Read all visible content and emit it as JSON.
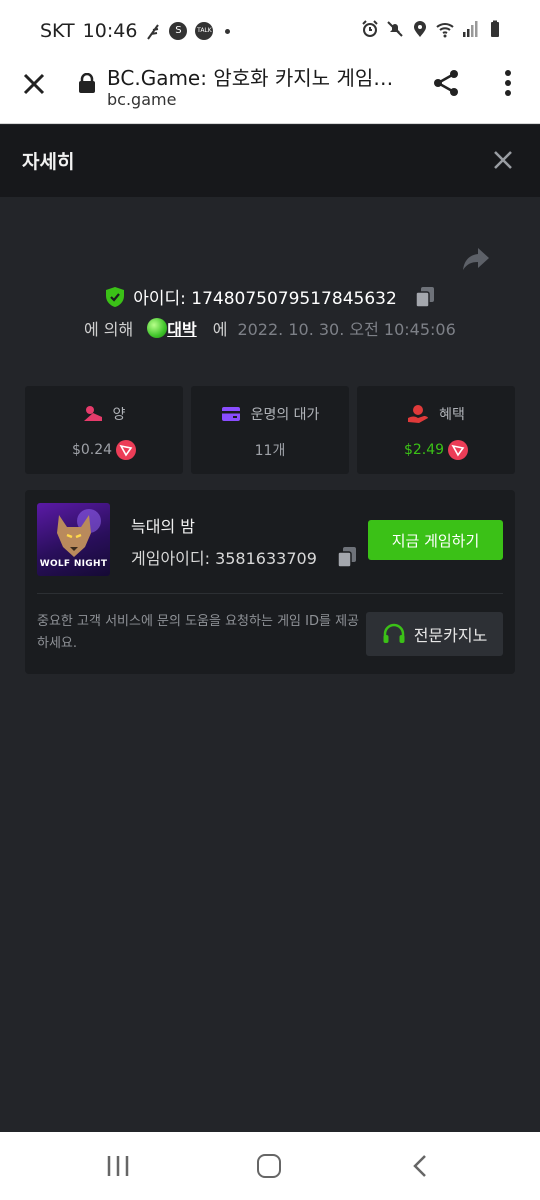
{
  "status_bar": {
    "carrier": "SKT",
    "time": "10:46",
    "notif_badge_1": "S",
    "notif_badge_2": "TALK"
  },
  "browser": {
    "title": "BC.Game: 암호화 카지노 게임…",
    "url": "bc.game"
  },
  "modal": {
    "title": "자세히"
  },
  "bet": {
    "id_label": "아이디: 1748075079517845632",
    "by_prefix": "에 의해",
    "username": "대박",
    "at_label": "에",
    "datetime": "2022. 10. 30. 오전 10:45:06"
  },
  "stats": [
    {
      "label": "양",
      "value": "$0.24",
      "value_color": "#9ea1a7",
      "icon": "bet-amount-icon",
      "icon_color": "#e63b6b"
    },
    {
      "label": "운명의 대가",
      "value": "11개",
      "value_color": "#9ea1a7",
      "icon": "wallet-card-icon",
      "icon_color": "#8a4dff"
    },
    {
      "label": "혜택",
      "value": "$2.49",
      "value_color": "#3bc117",
      "icon": "profit-hand-icon",
      "icon_color": "#e03a3a"
    }
  ],
  "game": {
    "thumb_text": "WOLF NIGHT",
    "name": "늑대의 밤",
    "id_text": "게임아이디: 3581633709",
    "play_label": "지금 게임하기",
    "support_note": "중요한 고객 서비스에 문의 도움을 요청하는 게임 ID를 제공하세요.",
    "support_label": "전문카지노"
  },
  "colors": {
    "accent": "#3bc117",
    "bg": "#232529",
    "card": "#1a1c1f",
    "trx": "#ec3d57"
  }
}
